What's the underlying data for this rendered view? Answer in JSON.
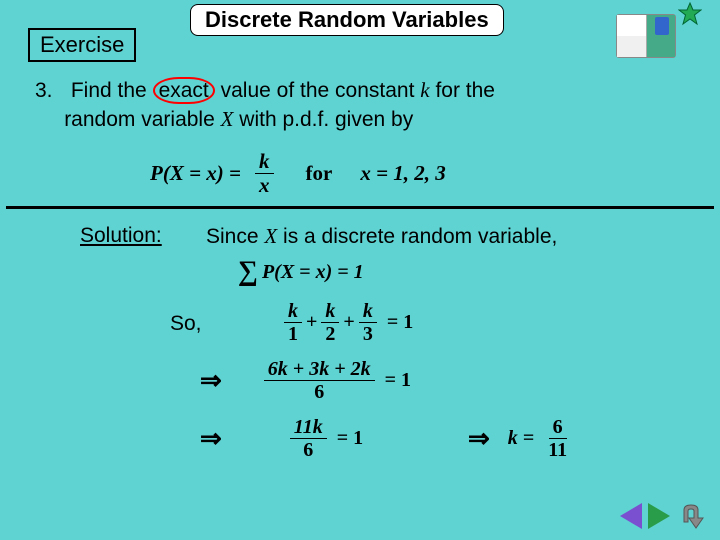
{
  "title": "Discrete Random Variables",
  "exercise_label": "Exercise",
  "question": {
    "number": "3.",
    "prefix": "Find the",
    "highlight": "exact",
    "mid1": "value of the constant",
    "var_k": "k",
    "mid2": "for the",
    "line2a": "random variable",
    "var_X": "X",
    "line2b": "with p.d.f. given by"
  },
  "formula": {
    "lhs": "P(X = x) =",
    "frac_num": "k",
    "frac_den": "x",
    "for": "for",
    "rhs": "x = 1, 2, 3"
  },
  "solution_label": "Solution:",
  "since": {
    "a": "Since",
    "X": "X",
    "b": "is a discrete random variable,"
  },
  "sum_line": "P(X = x) = 1",
  "so_label": "So,",
  "so_eq": {
    "t1n": "k",
    "t1d": "1",
    "t2n": "k",
    "t2d": "2",
    "t3n": "k",
    "t3d": "3",
    "eq": "= 1"
  },
  "line2": {
    "num": "6k + 3k + 2k",
    "den": "6",
    "eq": "= 1"
  },
  "line3a": {
    "num": "11k",
    "den": "6",
    "eq": "= 1"
  },
  "line3b": {
    "k": "k =",
    "num": "6",
    "den": "11"
  },
  "nav": {
    "back": "back",
    "fwd": "forward",
    "uturn": "return"
  }
}
